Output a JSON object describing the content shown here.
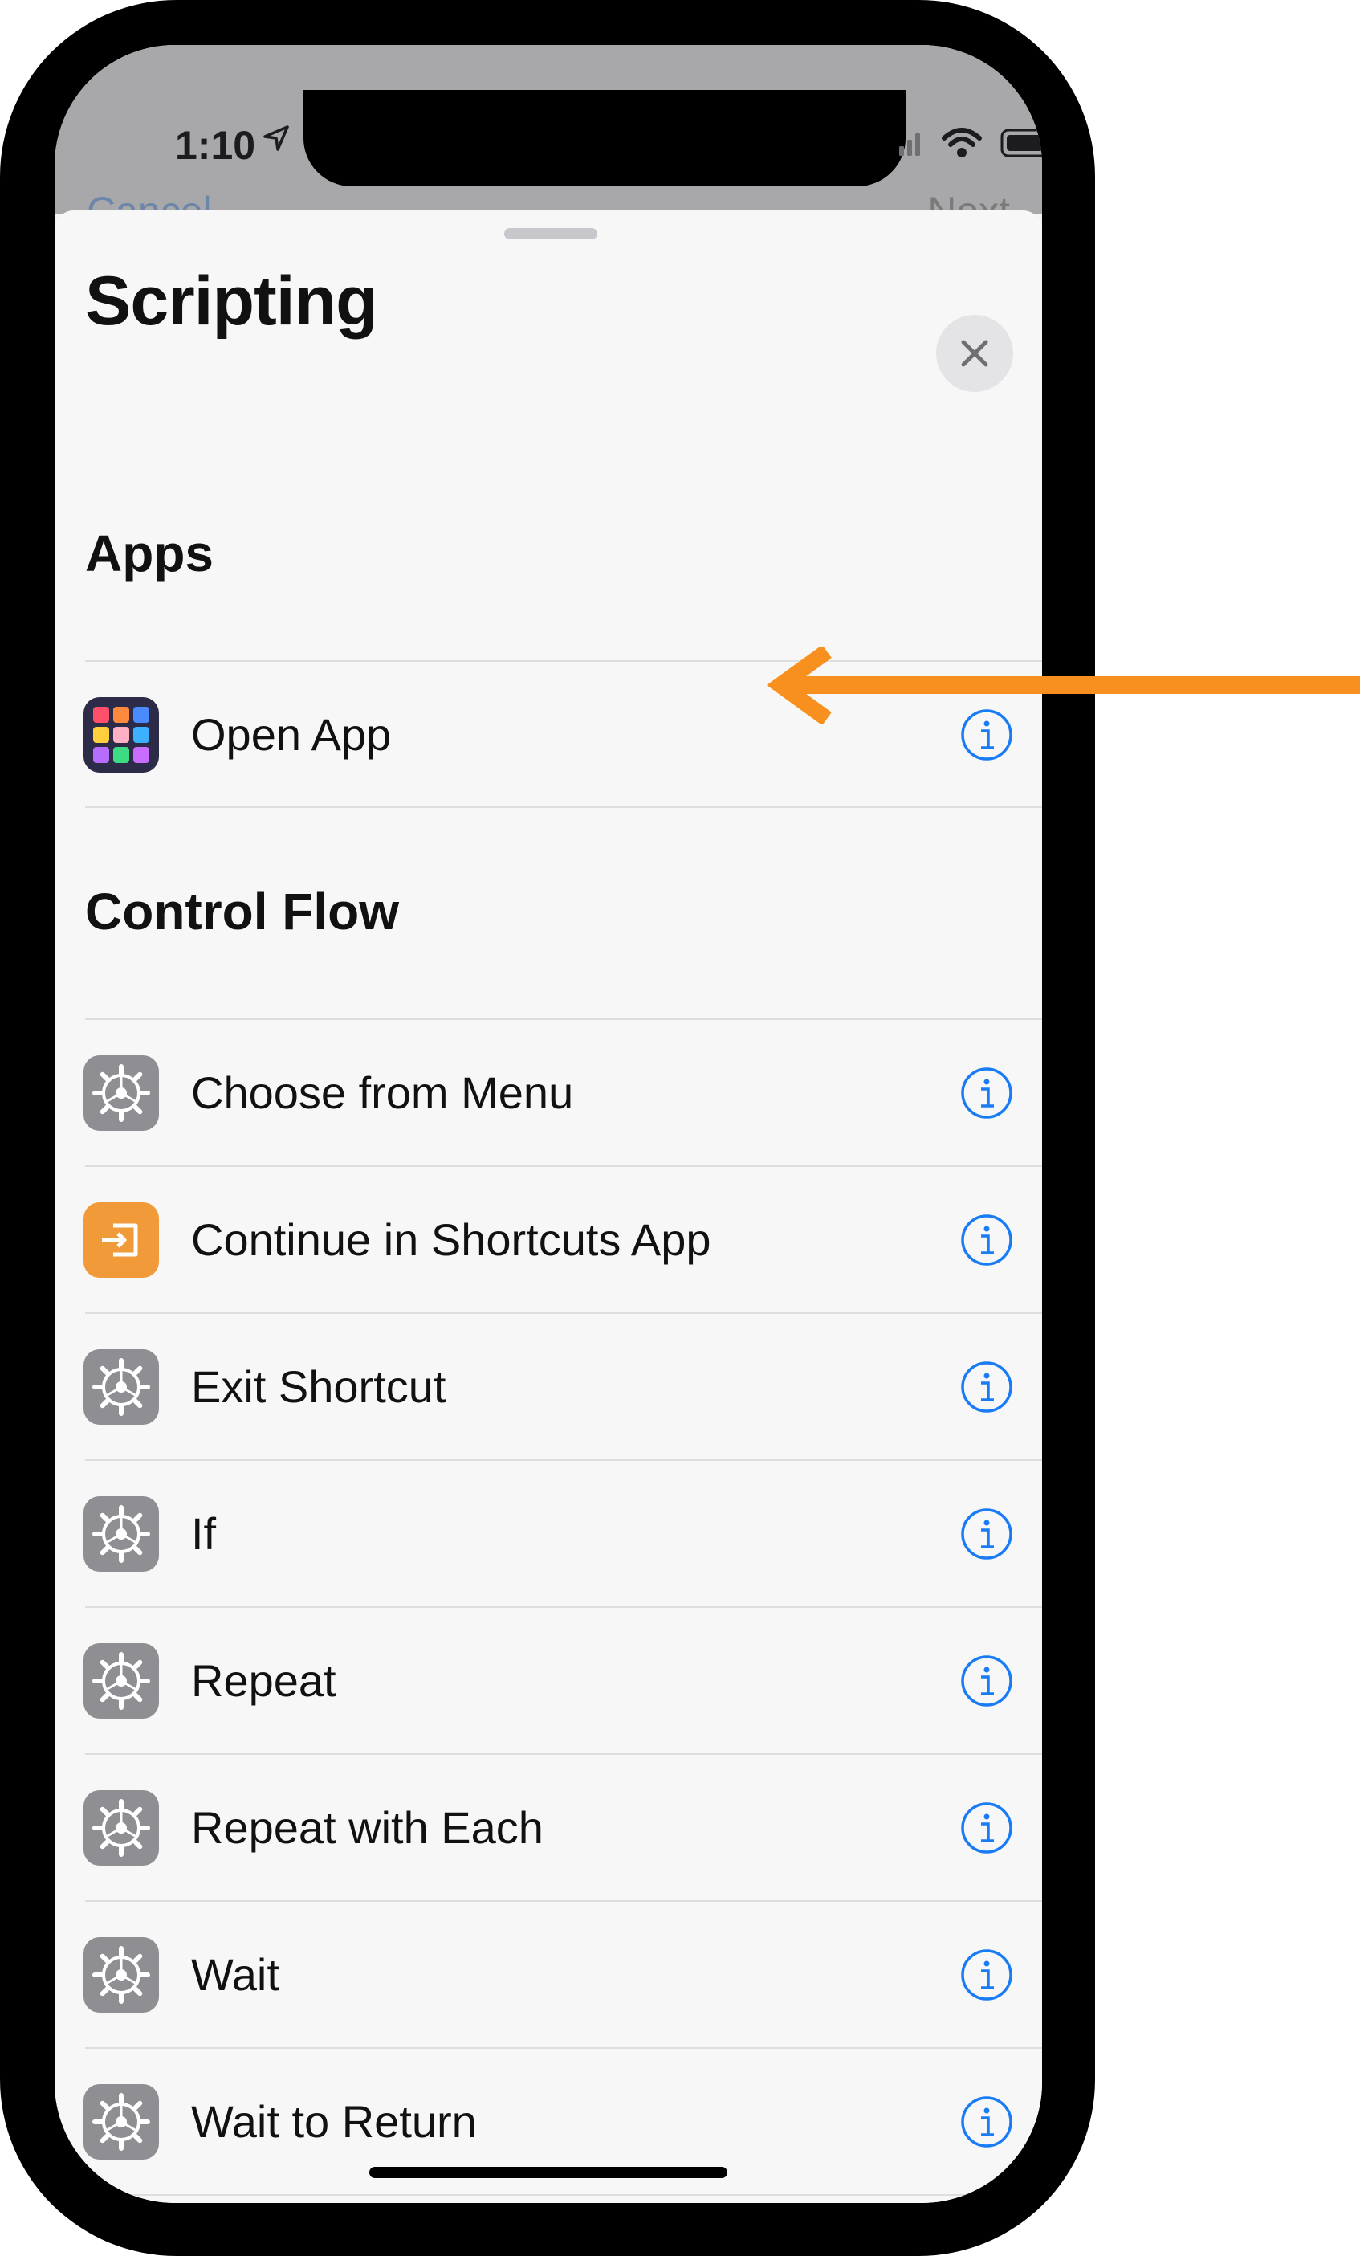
{
  "status_bar": {
    "time": "1:10"
  },
  "behind": {
    "left_label": "Cancel",
    "right_label": "Next"
  },
  "sheet": {
    "title": "Scripting"
  },
  "sections": [
    {
      "header": "Apps",
      "items": [
        {
          "label": "Open App",
          "icon": "open-app-icon"
        }
      ]
    },
    {
      "header": "Control Flow",
      "items": [
        {
          "label": "Choose from Menu",
          "icon": "gear-icon"
        },
        {
          "label": "Continue in Shortcuts App",
          "icon": "continue-icon"
        },
        {
          "label": "Exit Shortcut",
          "icon": "gear-icon"
        },
        {
          "label": "If",
          "icon": "gear-icon"
        },
        {
          "label": "Repeat",
          "icon": "gear-icon"
        },
        {
          "label": "Repeat with Each",
          "icon": "gear-icon"
        },
        {
          "label": "Wait",
          "icon": "gear-icon"
        },
        {
          "label": "Wait to Return",
          "icon": "gear-icon"
        }
      ]
    }
  ],
  "colors": {
    "accent": "#1a7cf5",
    "annotation_arrow": "#f7901e",
    "gear_tile": "#8e8e93",
    "continue_tile": "#f09a3a"
  }
}
